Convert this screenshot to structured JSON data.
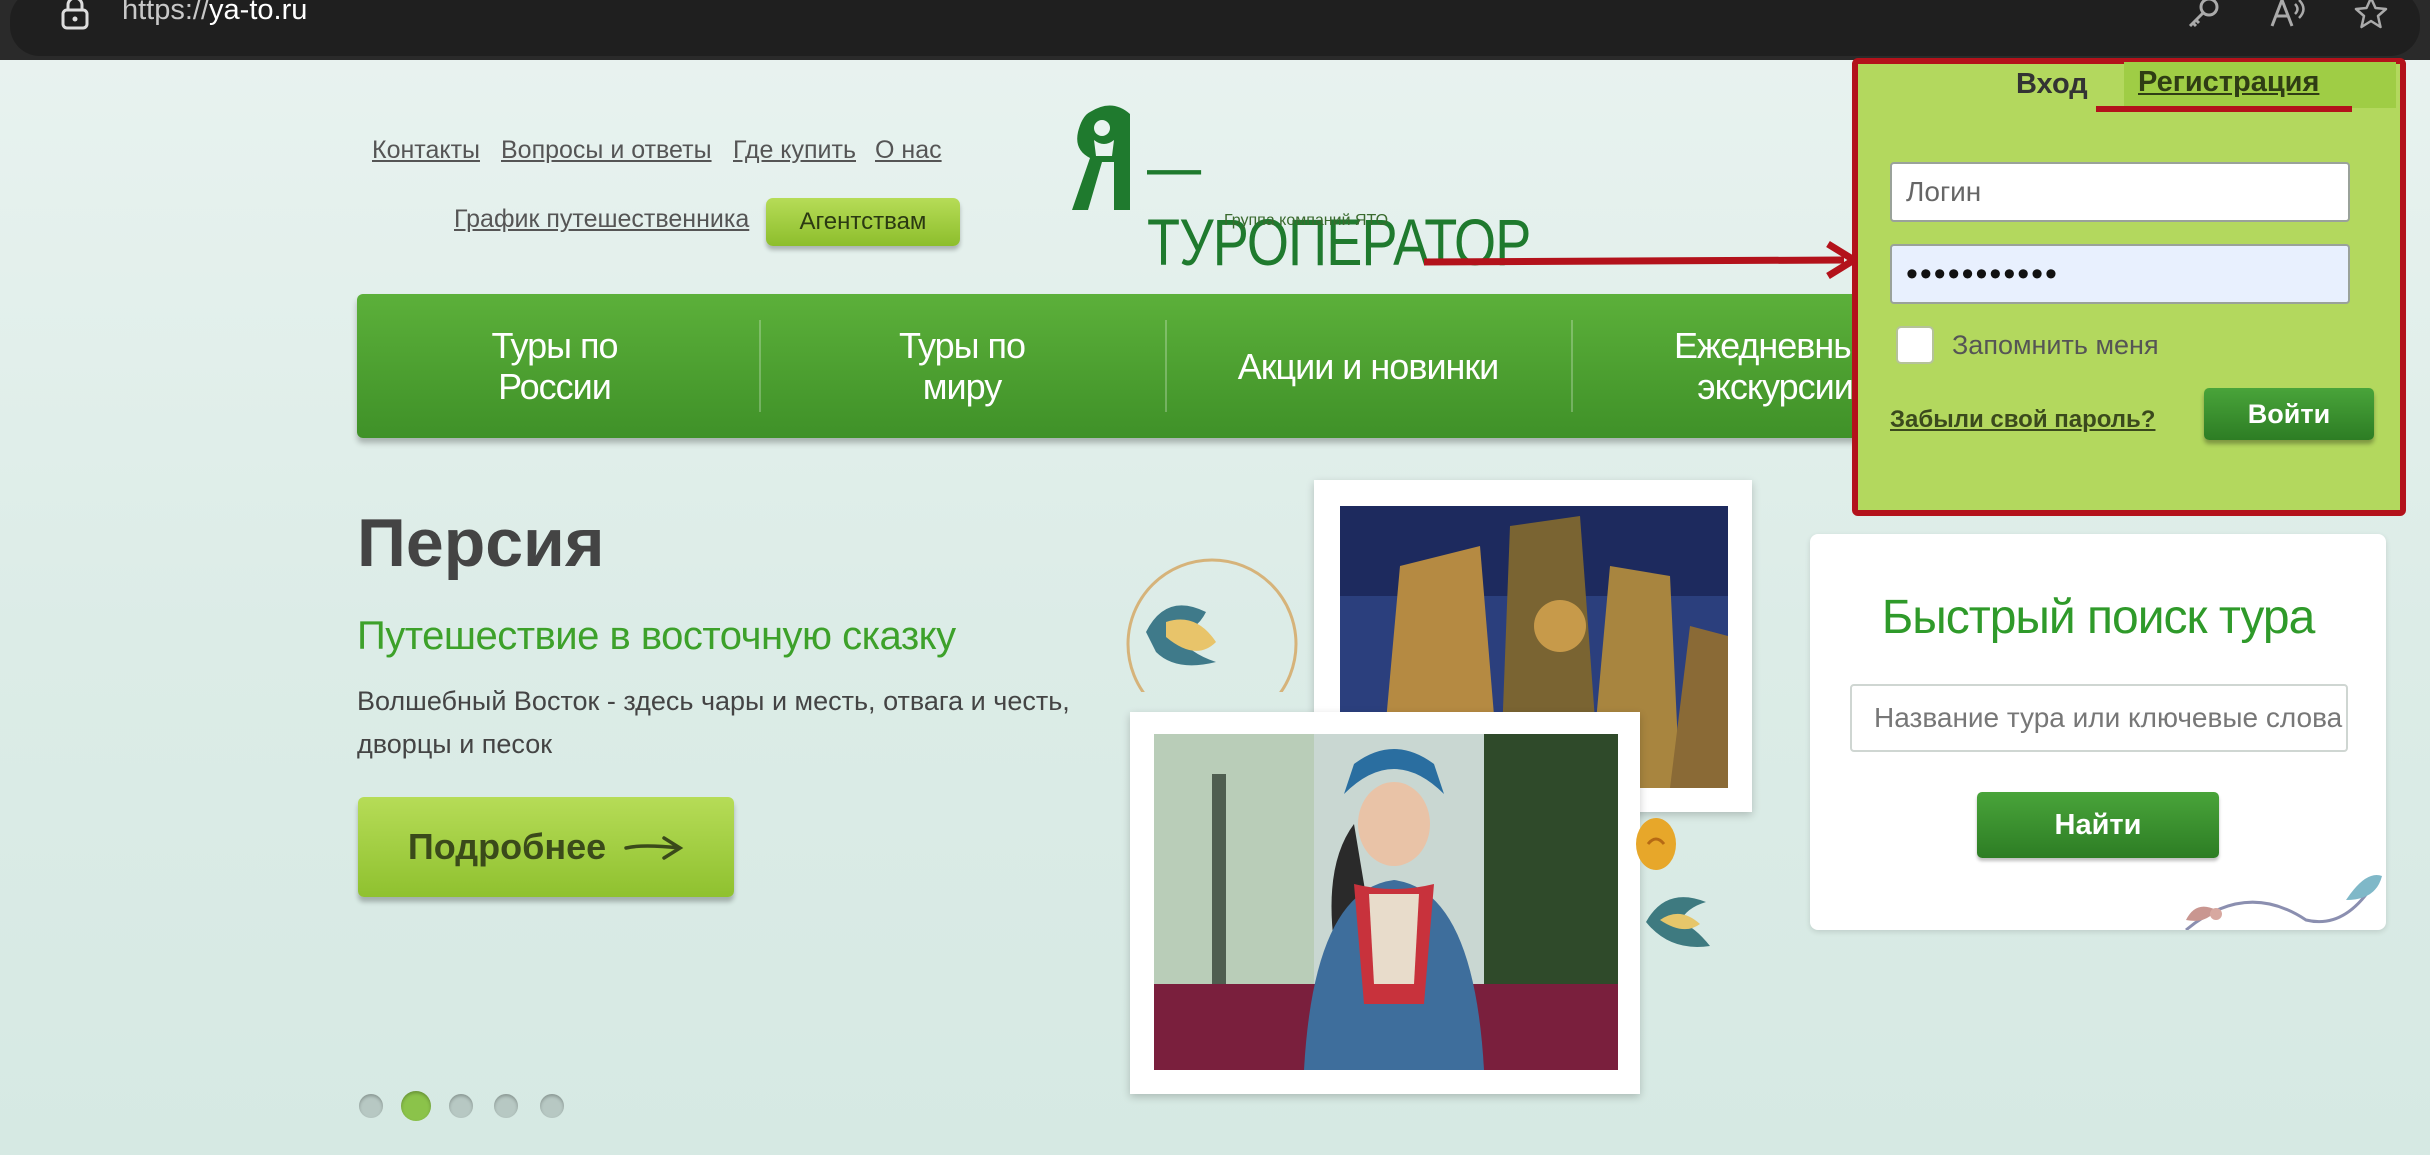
{
  "browser": {
    "url_scheme": "https://",
    "url_host": "ya-to.ru",
    "icons": [
      "lock-icon",
      "key-icon",
      "read-aloud-icon",
      "favorite-star-icon"
    ]
  },
  "header": {
    "links": {
      "contacts": "Контакты",
      "faq": "Вопросы и ответы",
      "where_to_buy": "Где купить",
      "about": "О нас",
      "traveler_schedule": "График путешественника"
    },
    "agency_button": "Агентствам"
  },
  "logo": {
    "text": "—ТУРОПЕРАТОР",
    "subtitle": "Группа компаний ЯТО"
  },
  "nav": {
    "items": [
      {
        "line1": "Туры по",
        "line2": "России"
      },
      {
        "line1": "Туры по",
        "line2": "миру"
      },
      {
        "line1": "Акции и новинки",
        "line2": ""
      },
      {
        "line1": "Ежедневны",
        "line2": "экскурсии"
      }
    ]
  },
  "hero": {
    "title": "Персия",
    "subtitle": "Путешествие в восточную сказку",
    "text": "Волшебный Восток - здесь чары и месть, отвага и честь, дворцы и песок",
    "button": "Подробнее",
    "slider": {
      "count": 5,
      "active_index": 1
    }
  },
  "login": {
    "tab_login": "Вход",
    "tab_register": "Регистрация",
    "login_placeholder": "Логин",
    "password_value": "•••••••••••",
    "remember_label": "Запомнить меня",
    "forgot_link": "Забыли свой пароль?",
    "submit_button": "Войти"
  },
  "quick_search": {
    "title": "Быстрый поиск тура",
    "placeholder": "Название тура или ключевые слова",
    "button": "Найти"
  },
  "colors": {
    "brand_green": "#3f9128",
    "accent_lime": "#b6dc57",
    "highlight_red": "#b3121b"
  }
}
